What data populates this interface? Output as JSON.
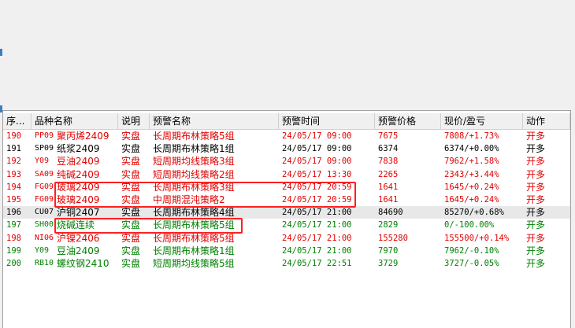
{
  "columns": [
    "序...",
    "品种名称",
    "说明",
    "预警名称",
    "预警时间",
    "预警价格",
    "现价/盈亏",
    "动作"
  ],
  "colors": {
    "up": "#e00000",
    "flat": "#000000",
    "down": "#008000",
    "highlight": "#ff2020"
  },
  "rows": [
    {
      "seq": "190",
      "code": "PP09",
      "name": "聚丙烯2409",
      "desc": "实盘",
      "alert": "长周期布林策略5组",
      "time": "24/05/17 09:00",
      "price": "7675",
      "now": "7808/+1.73%",
      "action": "开多",
      "color": "red",
      "selected": false
    },
    {
      "seq": "191",
      "code": "SP09",
      "name": "纸浆2409",
      "desc": "实盘",
      "alert": "长周期布林策略1组",
      "time": "24/05/17 09:00",
      "price": "6374",
      "now": "6374/+0.00%",
      "action": "开多",
      "color": "black",
      "selected": false
    },
    {
      "seq": "192",
      "code": "Y09",
      "name": "豆油2409",
      "desc": "实盘",
      "alert": "短周期均线策略3组",
      "time": "24/05/17 09:00",
      "price": "7838",
      "now": "7962/+1.58%",
      "action": "开多",
      "color": "red",
      "selected": false
    },
    {
      "seq": "193",
      "code": "SA09",
      "name": "纯碱2409",
      "desc": "实盘",
      "alert": "短周期均线策略2组",
      "time": "24/05/17 13:30",
      "price": "2265",
      "now": "2343/+3.44%",
      "action": "开多",
      "color": "red",
      "selected": false
    },
    {
      "seq": "194",
      "code": "FG09",
      "name": "玻璃2409",
      "desc": "实盘",
      "alert": "长周期布林策略3组",
      "time": "24/05/17 20:59",
      "price": "1641",
      "now": "1645/+0.24%",
      "action": "开多",
      "color": "red",
      "selected": false
    },
    {
      "seq": "195",
      "code": "FG09",
      "name": "玻璃2409",
      "desc": "实盘",
      "alert": "中周期混沌策略2",
      "time": "24/05/17 20:59",
      "price": "1641",
      "now": "1645/+0.24%",
      "action": "开多",
      "color": "red",
      "selected": false
    },
    {
      "seq": "196",
      "code": "CU07",
      "name": "沪铜2407",
      "desc": "实盘",
      "alert": "长周期布林策略4组",
      "time": "24/05/17 21:00",
      "price": "84690",
      "now": "85270/+0.68%",
      "action": "开多",
      "color": "black",
      "selected": true
    },
    {
      "seq": "197",
      "code": "SH00",
      "name": "烧碱连续",
      "desc": "实盘",
      "alert": "长周期布林策略5组",
      "time": "24/05/17 21:00",
      "price": "2829",
      "now": "0/-100.00%",
      "action": "开多",
      "color": "green",
      "selected": false
    },
    {
      "seq": "198",
      "code": "NI06",
      "name": "沪镍2406",
      "desc": "实盘",
      "alert": "长周期布林策略5组",
      "time": "24/05/17 21:00",
      "price": "155280",
      "now": "155500/+0.14%",
      "action": "开多",
      "color": "red",
      "selected": false
    },
    {
      "seq": "199",
      "code": "Y09",
      "name": "豆油2409",
      "desc": "实盘",
      "alert": "长周期布林策略1组",
      "time": "24/05/17 21:00",
      "price": "7970",
      "now": "7962/-0.10%",
      "action": "开多",
      "color": "green",
      "selected": false
    },
    {
      "seq": "200",
      "code": "RB10",
      "name": "螺纹钢2410",
      "desc": "实盘",
      "alert": "短周期均线策略5组",
      "time": "24/05/17 22:51",
      "price": "3729",
      "now": "3727/-0.05%",
      "action": "开多",
      "color": "green",
      "selected": false
    }
  ]
}
